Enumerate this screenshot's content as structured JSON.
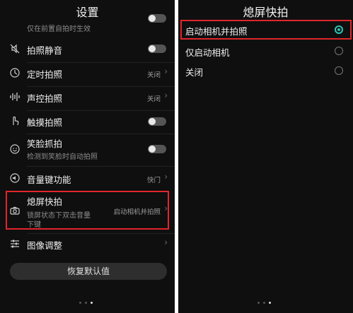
{
  "left": {
    "title": "设置",
    "top_partial": {
      "sub": "仅在前置自拍时生效"
    },
    "items": [
      {
        "label": "拍照静音",
        "icon": "mute-camera-icon",
        "toggle": "off"
      },
      {
        "label": "定时拍照",
        "icon": "timer-icon",
        "value": "关闭"
      },
      {
        "label": "声控拍照",
        "icon": "sound-wave-icon",
        "value": "关闭"
      },
      {
        "label": "触摸拍照",
        "icon": "touch-hand-icon",
        "toggle": "off"
      },
      {
        "label": "笑脸抓拍",
        "sub": "检测到笑脸时自动拍照",
        "icon": "smile-icon",
        "toggle": "off"
      },
      {
        "label": "音量键功能",
        "icon": "volume-icon",
        "value": "快门"
      },
      {
        "label": "熄屏快拍",
        "sub_line1": "锁屏状态下双击音量",
        "sub_line2": "下键",
        "icon": "camera-icon",
        "value": "启动相机并拍照",
        "highlighted": true
      },
      {
        "label": "图像调整",
        "icon": "sliders-icon"
      }
    ],
    "reset_button": "恢复默认值"
  },
  "right": {
    "title": "熄屏快拍",
    "options": [
      {
        "label": "启动相机并拍照",
        "selected": true,
        "highlighted": true
      },
      {
        "label": "仅启动相机",
        "selected": false
      },
      {
        "label": "关闭",
        "selected": false
      }
    ]
  },
  "colors": {
    "background": "#0f0f0f",
    "highlight": "#e0262b",
    "accent": "#2ec4b6"
  }
}
